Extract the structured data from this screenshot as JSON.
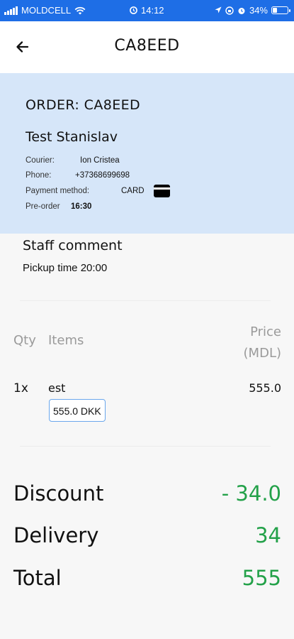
{
  "status_bar": {
    "carrier": "MOLDCELL",
    "time": "14:12",
    "battery": "34%",
    "battery_level": 0.34
  },
  "header": {
    "title": "CA8EED"
  },
  "order": {
    "title": "ORDER: CA8EED",
    "customer": "Test Stanislav",
    "courier_label": "Courier:",
    "courier": "Ion Cristea",
    "phone_label": "Phone:",
    "phone": "+37368699698",
    "payment_label": "Payment method:",
    "payment": "CARD",
    "preorder_label": "Pre-order",
    "preorder": "16:30"
  },
  "staff_comment": {
    "title": "Staff comment",
    "text": "Pickup time 20:00"
  },
  "items_table": {
    "qty_header": "Qty",
    "items_header": "Items",
    "price_header_1": "Price",
    "price_header_2": "(MDL)",
    "rows": [
      {
        "qty": "1x",
        "name": "est",
        "price": "555.0",
        "badge": "555.0 DKK"
      }
    ]
  },
  "totals": {
    "discount_label": "Discount",
    "discount": "- 34.0",
    "delivery_label": "Delivery",
    "delivery": "34",
    "total_label": "Total",
    "total": "555"
  },
  "colors": {
    "status_bar": "#1e6ee6",
    "card_background": "#d6e6f9",
    "accent_green": "#23a149"
  },
  "icons": [
    "signal-icon",
    "wifi-icon",
    "alarm-icon",
    "location-icon",
    "battery-icon",
    "back-arrow-icon",
    "credit-card-icon"
  ]
}
